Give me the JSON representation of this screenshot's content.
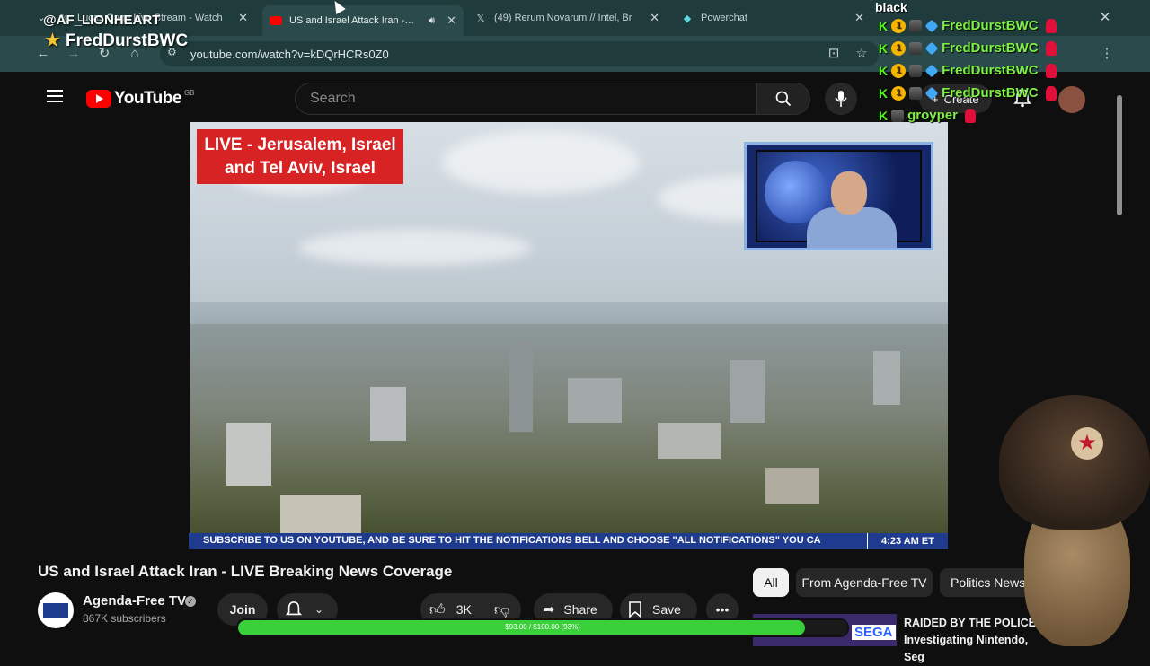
{
  "browser": {
    "tabs": [
      {
        "title": "Lucas Gage Live Stream - Watch",
        "favicon": "x-icon",
        "active": false
      },
      {
        "title": "US and Israel Attack Iran - LIVE",
        "favicon": "youtube-icon",
        "active": true
      },
      {
        "title": "(49) Rerum Novarum // Intel, Br",
        "favicon": "x-icon",
        "active": false
      },
      {
        "title": "Powerchat",
        "favicon": "powerchat-icon",
        "active": false
      }
    ],
    "url": "youtube.com/watch?v=kDQrHCRs0Z0"
  },
  "youtube": {
    "logo_text": "YouTube",
    "country_code": "GB",
    "search_placeholder": "Search",
    "create_label": "Create"
  },
  "video": {
    "live_badge": "LIVE - Jerusalem, Israel and Tel Aviv, Israel",
    "ticker_text": "SUBSCRIBE TO US ON YOUTUBE, AND BE SURE TO HIT THE NOTIFICATIONS BELL AND CHOOSE \"ALL NOTIFICATIONS\"    YOU CA",
    "ticker_time": "4:23 AM ET",
    "title": "US and Israel Attack Iran - LIVE Breaking News Coverage"
  },
  "channel": {
    "name": "Agenda-Free TV",
    "subscribers": "867K subscribers",
    "join_label": "Join"
  },
  "actions": {
    "likes": "3K",
    "share_label": "Share",
    "save_label": "Save"
  },
  "chips": [
    "All",
    "From Agenda-Free TV",
    "Politics News"
  ],
  "recommendation": {
    "title": "RAIDED BY THE POLICE - Investigating Nintendo, Seg",
    "thumb_text": "SEGA"
  },
  "overlay": {
    "handle": "@AF_LIONHEART",
    "username": "FredDurstBWC",
    "chat_label": "black",
    "chat_users": [
      "FredDurstBWC",
      "FredDurstBWC",
      "FredDurstBWC",
      "FredDurstBWC",
      "groyper"
    ],
    "progress_label": "$93.00 / $100.00 (93%)",
    "progress_fraction": 0.93
  }
}
